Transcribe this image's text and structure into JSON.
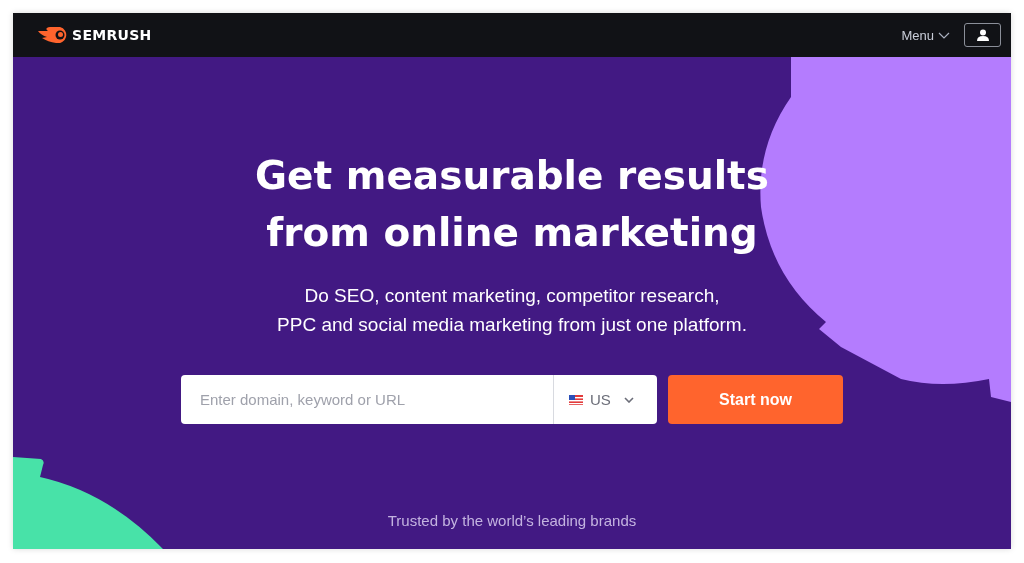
{
  "header": {
    "logo": "SEMRUSH",
    "menu": "Menu"
  },
  "hero": {
    "heading": [
      "Get measurable results",
      "from online marketing"
    ],
    "subtitle": [
      "Do SEO, content marketing, competitor research,",
      "PPC and social media marketing from just one platform."
    ],
    "search": {
      "placeholder": "Enter domain, keyword or URL",
      "country": "US"
    },
    "button": "Start now",
    "trusted": "Trusted by the world’s leading brands"
  }
}
